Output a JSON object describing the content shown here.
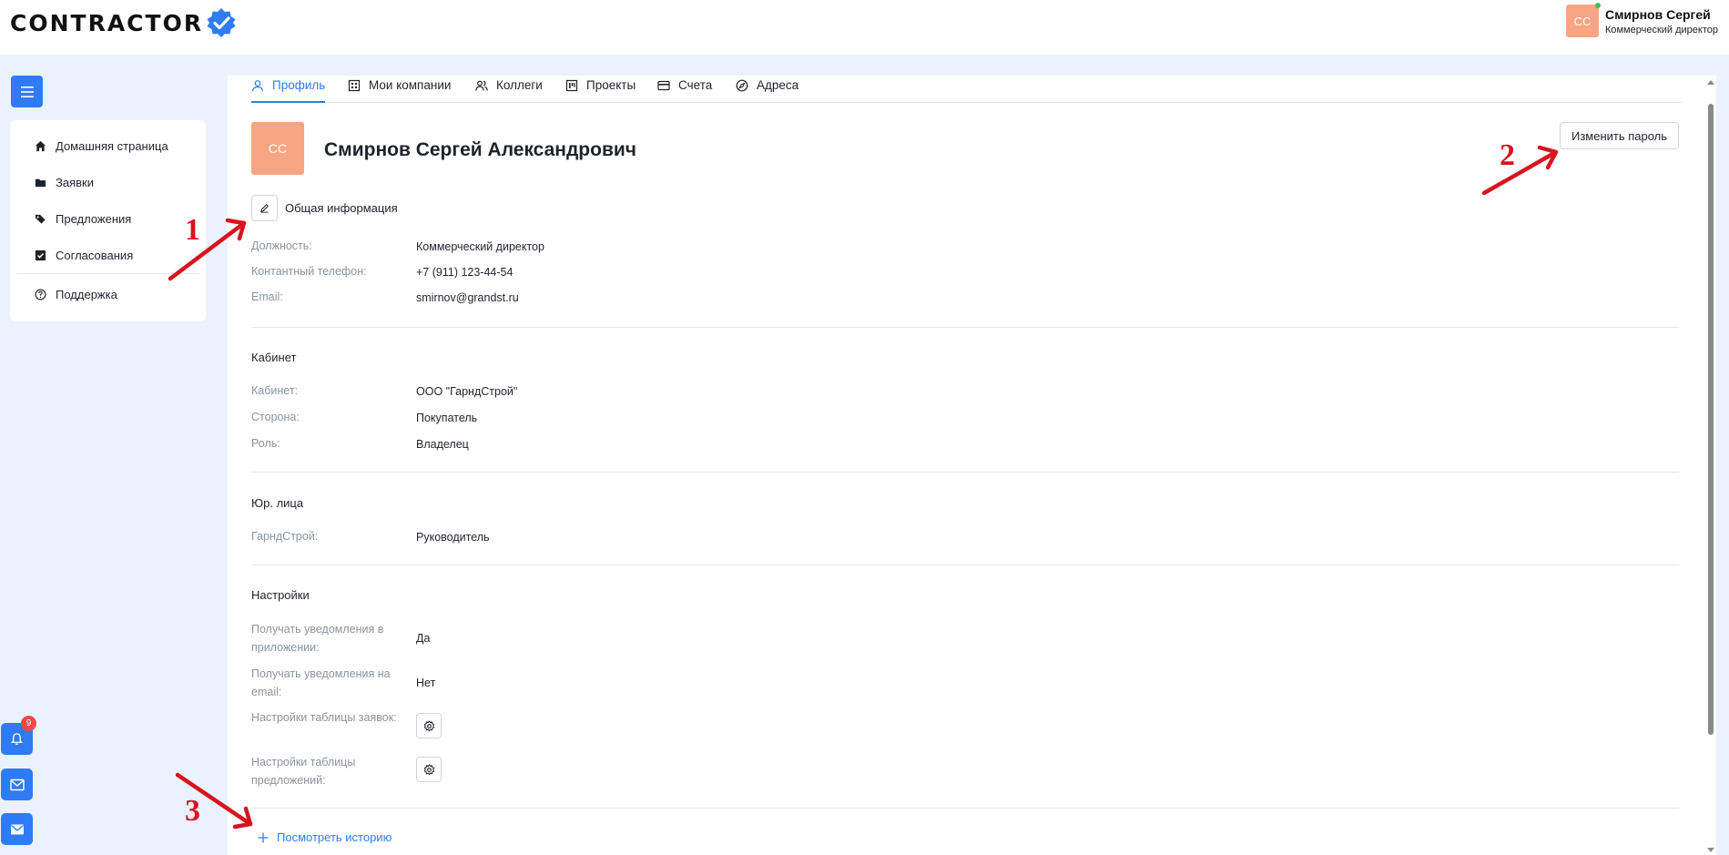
{
  "app": {
    "logo_text": "CONTRACTOR"
  },
  "user": {
    "initials": "СС",
    "name": "Смирнов Сергей",
    "role": "Коммерческий директор"
  },
  "sidebar": {
    "items": [
      {
        "label": "Домашняя страница",
        "icon": "home-icon"
      },
      {
        "label": "Заявки",
        "icon": "folder-icon"
      },
      {
        "label": "Предложения",
        "icon": "tags-icon"
      },
      {
        "label": "Согласования",
        "icon": "check-square-icon"
      },
      {
        "label": "Поддержка",
        "icon": "question-circle-icon"
      }
    ]
  },
  "floating": {
    "notification_count": "9"
  },
  "tabs": [
    {
      "label": "Профиль",
      "icon": "user-icon",
      "active": true
    },
    {
      "label": "Мои компании",
      "icon": "building-icon"
    },
    {
      "label": "Коллеги",
      "icon": "users-icon"
    },
    {
      "label": "Проекты",
      "icon": "project-icon"
    },
    {
      "label": "Счета",
      "icon": "credit-card-icon"
    },
    {
      "label": "Адреса",
      "icon": "compass-icon"
    }
  ],
  "profile": {
    "initials": "СС",
    "full_name": "Смирнов Сергей Александрович",
    "change_password": "Изменить пароль",
    "general_title": "Общая информация",
    "general": [
      {
        "label": "Должность:",
        "value": "Коммерческий директор"
      },
      {
        "label": "Контантный телефон:",
        "value": "+7 (911) 123-44-54"
      },
      {
        "label": "Email:",
        "value": "smirnov@grandst.ru"
      }
    ],
    "cabinet_title": "Кабинет",
    "cabinet": [
      {
        "label": "Кабинет:",
        "value": "ООО \"ГарндСтрой\""
      },
      {
        "label": "Сторона:",
        "value": "Покупатель"
      },
      {
        "label": "Роль:",
        "value": "Владелец"
      }
    ],
    "legal_title": "Юр. лица",
    "legal": [
      {
        "label": "ГарндСтрой:",
        "value": "Руководитель"
      }
    ],
    "settings_title": "Настройки",
    "settings": [
      {
        "label": "Получать уведомления в приложении:",
        "value": "Да"
      },
      {
        "label": "Получать уведомления на email:",
        "value": "Нет"
      },
      {
        "label": "Настройки таблицы заявок:",
        "value": ""
      },
      {
        "label": "Настройки таблицы предложений:",
        "value": ""
      }
    ],
    "history_link": "Посмотреть историю"
  },
  "annotations": {
    "one": "1",
    "two": "2",
    "three": "3",
    "color": "#d8141e"
  },
  "colors": {
    "accent": "#2f7bf5",
    "avatar": "#f7a582",
    "page_bg": "#eaf2fd",
    "badge": "#f04848"
  }
}
